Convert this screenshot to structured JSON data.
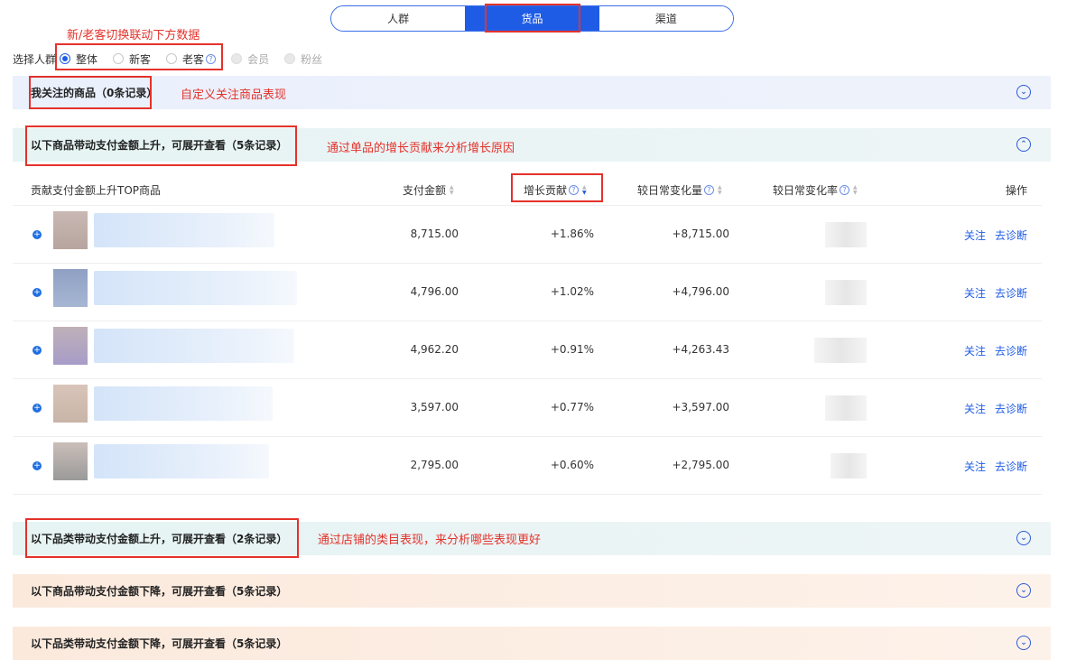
{
  "tabs": [
    {
      "label": "人群"
    },
    {
      "label": "货品"
    },
    {
      "label": "渠道"
    }
  ],
  "annotations": {
    "switch_note": "新/老客切换联动下方数据",
    "follow_note": "自定义关注商品表现",
    "single_note": "通过单品的增长贡献来分析增长原因",
    "category_note": "通过店铺的类目表现，来分析哪些表现更好"
  },
  "crowd": {
    "label": "选择人群",
    "options": [
      {
        "label": "整体"
      },
      {
        "label": "新客"
      },
      {
        "label": "老客"
      },
      {
        "label": "会员"
      },
      {
        "label": "粉丝"
      }
    ]
  },
  "sections": {
    "follow": "我关注的商品（0条记录）",
    "item_up": "以下商品带动支付金额上升，可展开查看（5条记录）",
    "cat_up": "以下品类带动支付金额上升，可展开查看（2条记录）",
    "item_down": "以下商品带动支付金额下降，可展开查看（5条记录）",
    "cat_down": "以下品类带动支付金额下降，可展开查看（5条记录）"
  },
  "table": {
    "headers": {
      "product": "贡献支付金额上升TOP商品",
      "pay": "支付金额",
      "contrib": "增长贡献",
      "delta": "较日常变化量",
      "rate": "较日常变化率",
      "ops": "操作"
    },
    "rows": [
      {
        "pay": "8,715.00",
        "contrib": "+1.86%",
        "delta": "+8,715.00"
      },
      {
        "pay": "4,796.00",
        "contrib": "+1.02%",
        "delta": "+4,796.00"
      },
      {
        "pay": "4,962.20",
        "contrib": "+0.91%",
        "delta": "+4,263.43"
      },
      {
        "pay": "3,597.00",
        "contrib": "+0.77%",
        "delta": "+3,597.00"
      },
      {
        "pay": "2,795.00",
        "contrib": "+0.60%",
        "delta": "+2,795.00"
      }
    ],
    "op_follow": "关注",
    "op_diagnose": "去诊断"
  },
  "colors": {
    "accent": "#1f5ce6",
    "annotation": "#e4322b"
  },
  "icons": {
    "chevron": "chevron-icon",
    "help": "help-icon",
    "expand": "plus-circle-icon"
  }
}
